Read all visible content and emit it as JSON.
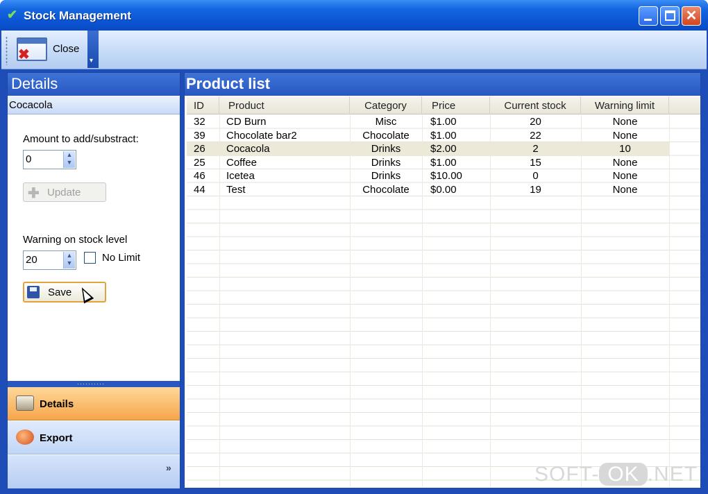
{
  "window": {
    "title": "Stock Management"
  },
  "toolbar": {
    "close_label": "Close",
    "overflow": "▾"
  },
  "details": {
    "header": "Details",
    "selected_product": "Cocacola",
    "amount_label": "Amount to add/substract:",
    "amount_value": "0",
    "update_label": "Update",
    "warning_label": "Warning on stock level",
    "warning_value": "20",
    "no_limit_label": "No Limit",
    "no_limit_checked": false,
    "save_label": "Save"
  },
  "nav": {
    "splitter": "··········",
    "items": [
      {
        "label": "Details",
        "active": true,
        "icon": "folder-icon"
      },
      {
        "label": "Export",
        "active": false,
        "icon": "export-icon"
      }
    ],
    "more": "»"
  },
  "product_list": {
    "header": "Product list",
    "columns": [
      "ID",
      "Product",
      "Category",
      "Price",
      "Current stock",
      "Warning limit"
    ],
    "rows": [
      {
        "id": "32",
        "product": "CD Burn",
        "category": "Misc",
        "price": "$1.00",
        "stock": "20",
        "limit": "None",
        "selected": false
      },
      {
        "id": "39",
        "product": "Chocolate bar2",
        "category": "Chocolate",
        "price": "$1.00",
        "stock": "22",
        "limit": "None",
        "selected": false
      },
      {
        "id": "26",
        "product": "Cocacola",
        "category": "Drinks",
        "price": "$2.00",
        "stock": "2",
        "limit": "10",
        "selected": true
      },
      {
        "id": "25",
        "product": "Coffee",
        "category": "Drinks",
        "price": "$1.00",
        "stock": "15",
        "limit": "None",
        "selected": false
      },
      {
        "id": "46",
        "product": "Icetea",
        "category": "Drinks",
        "price": "$10.00",
        "stock": "0",
        "limit": "None",
        "selected": false
      },
      {
        "id": "44",
        "product": "Test",
        "category": "Chocolate",
        "price": "$0.00",
        "stock": "19",
        "limit": "None",
        "selected": false
      }
    ]
  },
  "watermark": {
    "pre": "SOFT-",
    "ok": "OK",
    "post": ".NET"
  },
  "colors": {
    "title_bar": "#0b55d4",
    "pane_header": "#2857c0",
    "active_nav": "#f6a54b",
    "selected_row": "#ece9d8"
  }
}
